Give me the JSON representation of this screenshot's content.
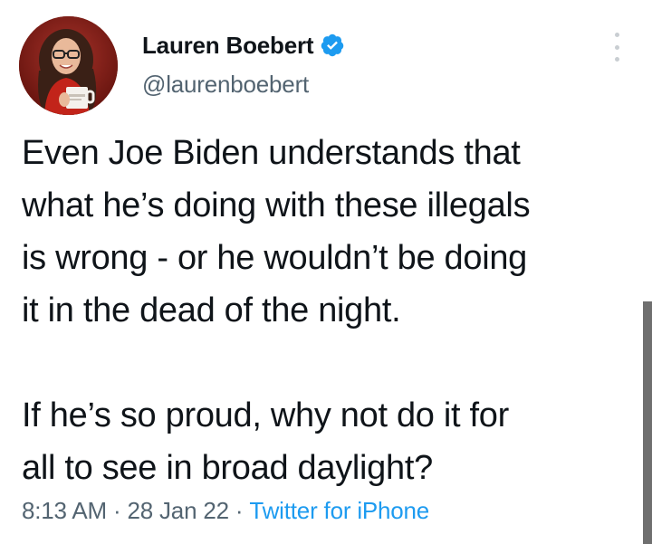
{
  "tweet": {
    "author": {
      "display_name": "Lauren Boebert",
      "handle": "@laurenboebert",
      "verified": true,
      "verified_icon": "verified-badge-icon",
      "avatar_icon": "profile-avatar"
    },
    "text_paragraphs": [
      {
        "lines": [
          "Even Joe Biden understands that",
          "what he’s doing with these illegals",
          "is wrong - or he wouldn’t be doing",
          "it in the dead of the night."
        ]
      },
      {
        "lines": [
          "If he’s so proud, why not do it for",
          "all to see in broad daylight?"
        ]
      }
    ],
    "meta": {
      "time": "8:13 AM",
      "separator": "·",
      "date": "28 Jan 22",
      "source": "Twitter for iPhone"
    },
    "more_icon": "more-options-icon"
  },
  "colors": {
    "text_primary": "#0f1419",
    "text_secondary": "#536471",
    "link": "#1d9bf0",
    "verified": "#1d9bf0"
  }
}
